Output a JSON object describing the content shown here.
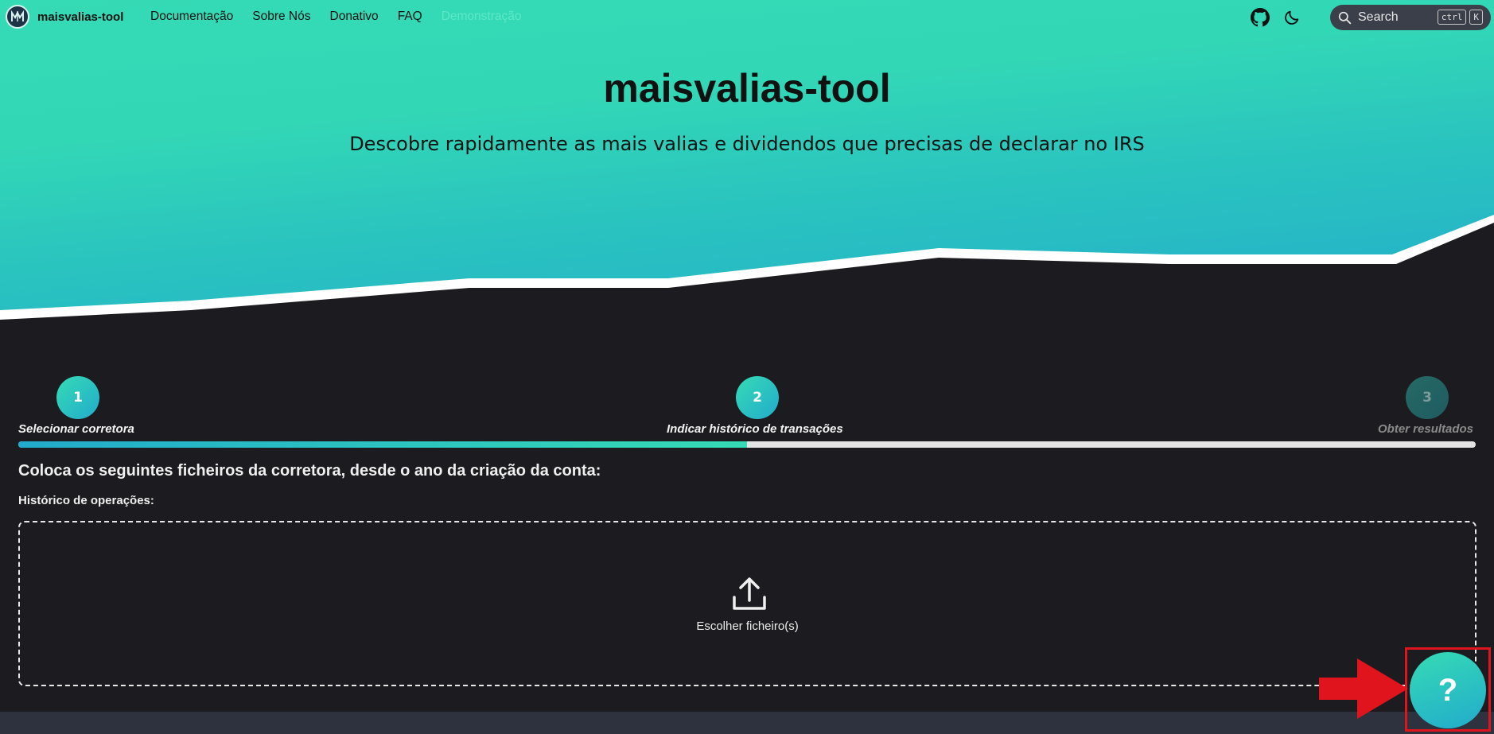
{
  "nav": {
    "brand": "maisvalias-tool",
    "links": [
      "Documentação",
      "Sobre Nós",
      "Donativo",
      "FAQ",
      "Demonstração"
    ],
    "active_link": "Demonstração",
    "github_icon": "github-icon",
    "theme_icon": "moon-icon",
    "search": {
      "placeholder": "Search",
      "shortcut": [
        "ctrl",
        "K"
      ]
    }
  },
  "hero": {
    "title": "maisvalias-tool",
    "subtitle": "Descobre rapidamente as mais valias e dividendos que precisas de declarar no IRS"
  },
  "stepper": {
    "steps": [
      {
        "number": "1",
        "label": "Selecionar corretora",
        "state": "done"
      },
      {
        "number": "2",
        "label": "Indicar histórico de transações",
        "state": "current"
      },
      {
        "number": "3",
        "label": "Obter resultados",
        "state": "pending"
      }
    ],
    "progress_percent": 50
  },
  "content": {
    "heading": "Coloca os seguintes ficheiros da corretora, desde o ano da criação da conta:",
    "field_label": "Histórico de operações:",
    "upload_label": "Escolher ficheiro(s)",
    "upload_icon": "upload-icon"
  },
  "help_button": {
    "label": "?"
  },
  "colors": {
    "accent_start": "#35dbb5",
    "accent_end": "#22abcc",
    "background": "#1c1b1f",
    "annotation": "#e0141c"
  }
}
